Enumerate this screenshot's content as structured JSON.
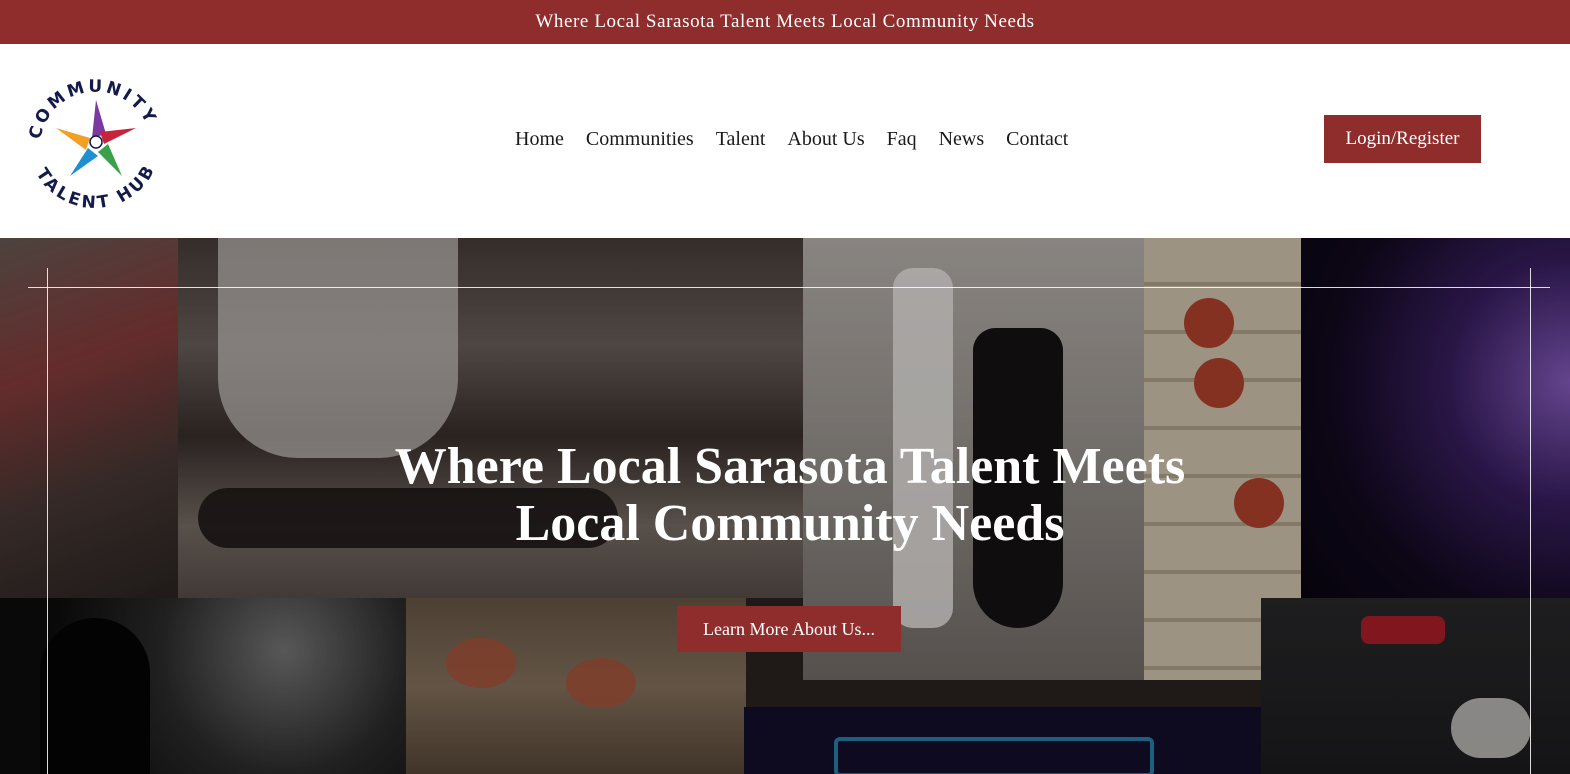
{
  "announcement": "Where Local Sarasota Talent Meets Local Community Needs",
  "logo": {
    "top_text": "COMMUNITY",
    "bottom_text": "TALENT HUB",
    "icon": "colorful-star-logo"
  },
  "nav": {
    "items": [
      "Home",
      "Communities",
      "Talent",
      "About Us",
      "Faq",
      "News",
      "Contact"
    ]
  },
  "login_label": "Login/Register",
  "hero": {
    "title_line1": "Where Local Sarasota Talent Meets",
    "title_line2": "Local Community Needs",
    "button_label": "Learn More About Us...",
    "background_photos": [
      "audience-photo",
      "yoga-photo",
      "dancing-couple-photo",
      "bingo-board-photo",
      "stage-light-photo",
      "singer-silhouette-photo",
      "bingo-chips-photo",
      "trivia-neon-photo",
      "magician-photo"
    ]
  },
  "colors": {
    "brand_red": "#8f2d2d",
    "white": "#ffffff"
  }
}
